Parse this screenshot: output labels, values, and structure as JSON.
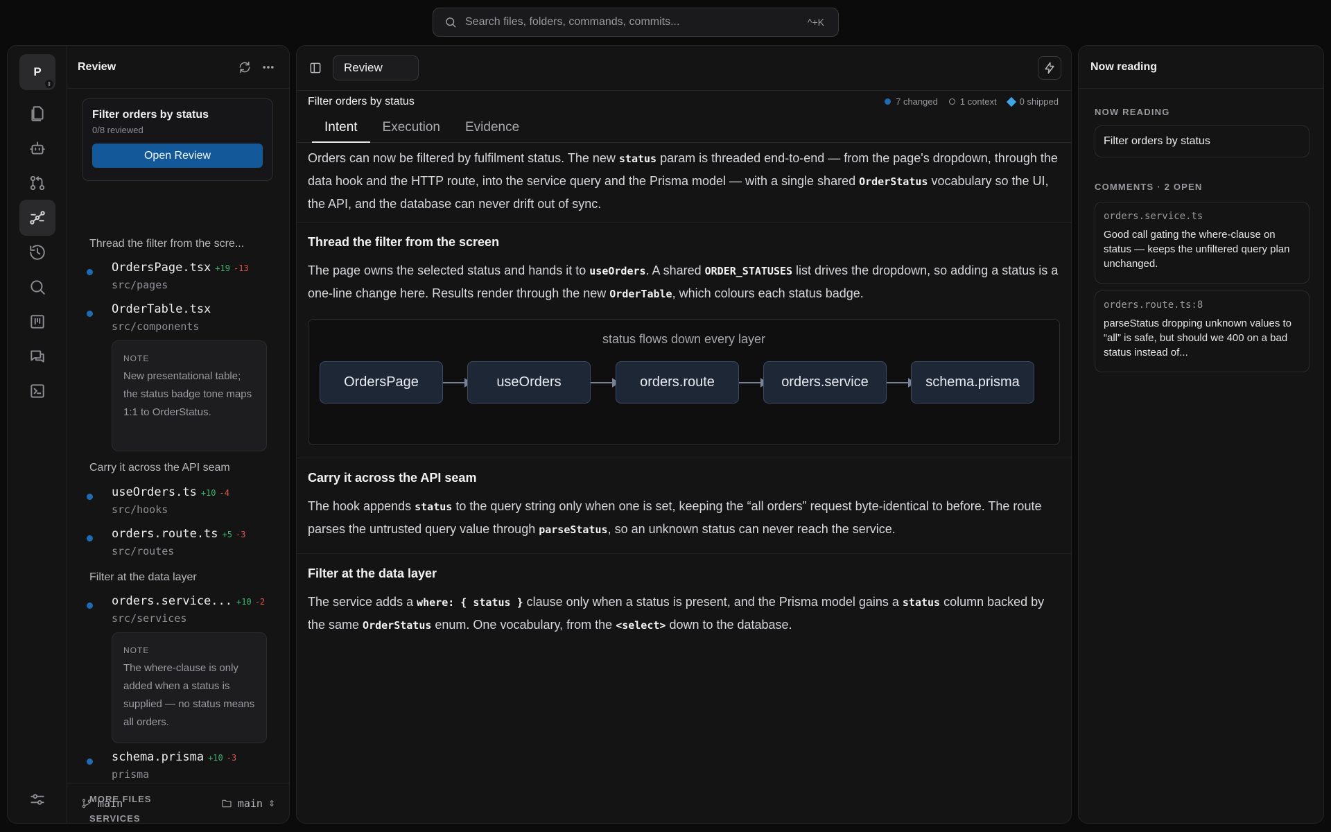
{
  "search": {
    "placeholder": "Search files, folders, commands, commits...",
    "shortcut": "^+K",
    "icon": "search-icon"
  },
  "rail": {
    "avatar": "P",
    "items": [
      {
        "icon": "files-icon"
      },
      {
        "icon": "robot-icon"
      },
      {
        "icon": "pull-request-icon"
      },
      {
        "icon": "flow-icon",
        "active": true
      },
      {
        "icon": "history-icon"
      },
      {
        "icon": "search-icon"
      },
      {
        "icon": "board-icon"
      },
      {
        "icon": "chat-icon"
      },
      {
        "icon": "terminal-icon"
      }
    ],
    "footer_icon": "settings-sliders-icon"
  },
  "left": {
    "title": "Review",
    "card": {
      "title": "Filter orders by status",
      "subtitle": "0/8 reviewed",
      "button": "Open Review"
    },
    "sections": [
      {
        "label": "Thread the filter from the scre..."
      },
      {
        "label": "Carry it across the API seam"
      },
      {
        "label": "Filter at the data layer"
      }
    ],
    "files": [
      {
        "name": "OrdersPage.tsx",
        "add": "+19",
        "del": "-13",
        "path": "src/pages"
      },
      {
        "name": "OrderTable.tsx",
        "add": "",
        "del": "",
        "path": "src/components"
      },
      {
        "name": "useOrders.ts",
        "add": "+10",
        "del": "-4",
        "path": "src/hooks"
      },
      {
        "name": "orders.route.ts",
        "add": "+5",
        "del": "-3",
        "path": "src/routes"
      },
      {
        "name": "orders.service...",
        "add": "+10",
        "del": "-2",
        "path": "src/services"
      },
      {
        "name": "schema.prisma",
        "add": "+10",
        "del": "-3",
        "path": "prisma"
      }
    ],
    "notes": [
      {
        "label": "NOTE",
        "text": "New presentational table; the status badge tone maps 1:1 to OrderStatus."
      },
      {
        "label": "NOTE",
        "text": "The where-clause is only added when a status is supplied — no status means all orders."
      }
    ],
    "more_files": "MORE FILES",
    "services": "SERVICES",
    "footer": {
      "branch": "main",
      "folder": "main"
    }
  },
  "center": {
    "tab_pill": "Review",
    "title": "Filter orders by status",
    "stats": {
      "changed": "7 changed",
      "context": "1 context",
      "shipped": "0 shipped"
    },
    "tabs": [
      "Intent",
      "Execution",
      "Evidence"
    ],
    "intro": {
      "p1": "Orders can now be filtered by fulfilment status. The new ",
      "c1": "status",
      "p2": " param is threaded end-to-end — from the page's dropdown, through the data hook and the HTTP route, into the service query and the Prisma model — with a single shared ",
      "c2": "OrderStatus",
      "p3": " vocabulary so the UI, the API, and the database can never drift out of sync."
    },
    "s1": {
      "title": "Thread the filter from the screen",
      "p1": "The page owns the selected status and hands it to ",
      "c1": "useOrders",
      "p2": ". A shared ",
      "c2": "ORDER_STATUSES",
      "p3": " list drives the dropdown, so adding a status is a one-line change here. Results render through the new ",
      "c3": "OrderTable",
      "p4": ", which colours each status badge."
    },
    "flow": {
      "title": "status flows down every layer",
      "nodes": [
        "OrdersPage",
        "useOrders",
        "orders.route",
        "orders.service",
        "schema.prisma"
      ]
    },
    "s2": {
      "title": "Carry it across the API seam",
      "p1": "The hook appends ",
      "c1": "status",
      "p2": " to the query string only when one is set, keeping the “all orders” request byte-identical to before. The route parses the untrusted query value through ",
      "c2": "parseStatus",
      "p3": ", so an unknown status can never reach the service."
    },
    "s3": {
      "title": "Filter at the data layer",
      "p1": "The service adds a ",
      "c1": "where: { status }",
      "p2": " clause only when a status is present, and the Prisma model gains a ",
      "c2": "status",
      "p3": " column backed by the same ",
      "c3": "OrderStatus",
      "p4": " enum. One vocabulary, from the ",
      "c4": "<select>",
      "p5": " down to the database."
    }
  },
  "right": {
    "title": "Now reading",
    "now_reading_label": "NOW READING",
    "now_reading_item": "Filter orders by status",
    "comments_label": "COMMENTS · 2 OPEN",
    "comments": [
      {
        "file": "orders.service.ts",
        "text": "Good call gating the where-clause on status — keeps the unfiltered query plan unchanged."
      },
      {
        "file": "orders.route.ts:8",
        "text": "parseStatus dropping unknown values to “all” is safe, but should we 400 on a bad status instead of..."
      }
    ]
  },
  "colors": {
    "accent": "#13599a",
    "dot": "#1e6bb5",
    "added": "#3fb56b",
    "deleted": "#e0564d",
    "shipped": "#3da5e8"
  }
}
